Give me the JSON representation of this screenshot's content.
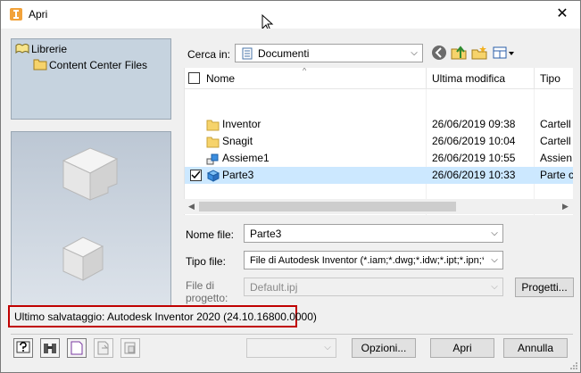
{
  "window": {
    "title": "Apri",
    "close_label": "✕"
  },
  "libraries": {
    "root_label": "Librerie",
    "child_label": "Content Center Files"
  },
  "lookin": {
    "label": "Cerca in:",
    "value": "Documenti"
  },
  "columns": {
    "name": "Nome",
    "modified": "Ultima modifica",
    "type": "Tipo"
  },
  "files": [
    {
      "name": "Inventor",
      "modified": "26/06/2019 09:38",
      "type": "Cartell",
      "icon": "folder-icon",
      "selected": false
    },
    {
      "name": "Snagit",
      "modified": "26/06/2019 10:04",
      "type": "Cartell",
      "icon": "folder-icon",
      "selected": false
    },
    {
      "name": "Assieme1",
      "modified": "26/06/2019 10:55",
      "type": "Assien",
      "icon": "assembly-icon",
      "selected": false
    },
    {
      "name": "Parte3",
      "modified": "26/06/2019 10:33",
      "type": "Parte c",
      "icon": "part-icon",
      "selected": true
    }
  ],
  "filename": {
    "label": "Nome file:",
    "value": "Parte3"
  },
  "filetype": {
    "label": "Tipo file:",
    "value": "File di Autodesk Inventor (*.iam;*.dwg;*.idw;*.ipt;*.ipn;*.ide"
  },
  "project": {
    "label_line1": "File di",
    "label_line2": "progetto:",
    "value": "Default.ipj",
    "button": "Progetti..."
  },
  "status": {
    "text": "Ultimo salvataggio: Autodesk Inventor 2020 (24.10.16800.0000)"
  },
  "buttons": {
    "options": "Opzioni...",
    "open": "Apri",
    "cancel": "Annulla"
  },
  "colors": {
    "selection": "#cce8ff",
    "highlight_border": "#c00000",
    "panel": "#c6d3df"
  }
}
